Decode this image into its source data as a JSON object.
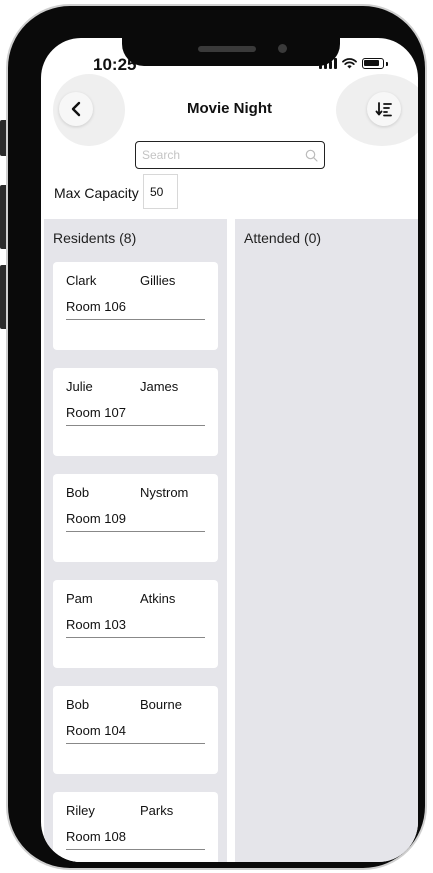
{
  "status": {
    "time": "10:25"
  },
  "header": {
    "title": "Movie Night"
  },
  "search": {
    "placeholder": "Search",
    "value": ""
  },
  "capacity": {
    "label": "Max Capacity",
    "value": "50"
  },
  "residents": {
    "header": "Residents (8)",
    "items": [
      {
        "first": "Clark",
        "last": "Gillies",
        "room": "Room 106"
      },
      {
        "first": "Julie",
        "last": "James",
        "room": "Room 107"
      },
      {
        "first": "Bob",
        "last": "Nystrom",
        "room": "Room 109"
      },
      {
        "first": "Pam",
        "last": "Atkins",
        "room": "Room 103"
      },
      {
        "first": "Bob",
        "last": "Bourne",
        "room": "Room 104"
      },
      {
        "first": "Riley",
        "last": "Parks",
        "room": "Room 108"
      }
    ]
  },
  "attended": {
    "header": "Attended (0)"
  },
  "icons": {
    "back": "chevron-left-icon",
    "sort": "sort-icon",
    "search": "search-icon",
    "signal": "signal-icon",
    "wifi": "wifi-icon",
    "battery": "battery-icon"
  },
  "colors": {
    "column_bg": "#e5e5ea",
    "card_bg": "#ffffff",
    "frame": "#0a0a0a"
  }
}
